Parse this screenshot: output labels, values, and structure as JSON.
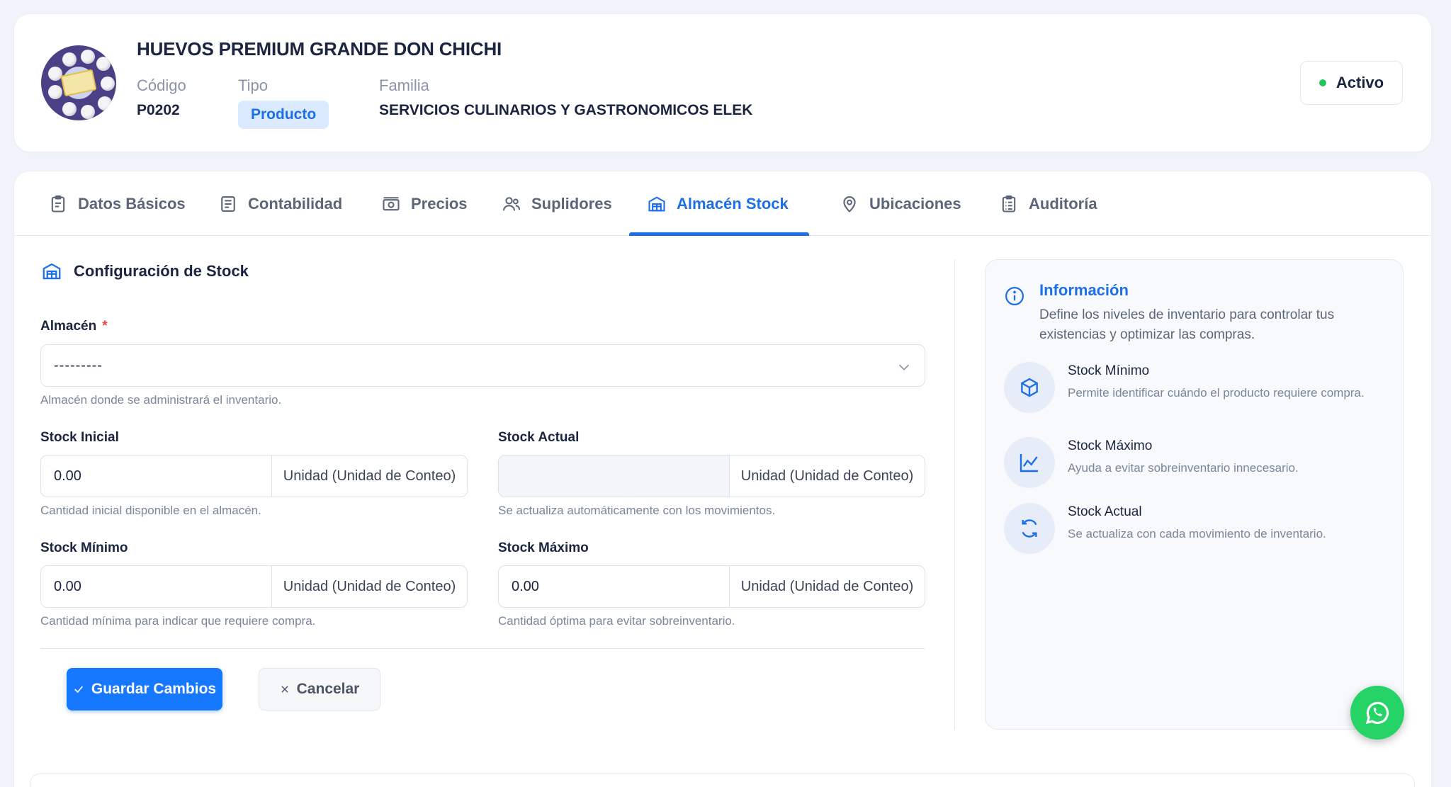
{
  "product": {
    "name": "HUEVOS PREMIUM GRANDE DON CHICHI",
    "code_label": "Código",
    "code": "P0202",
    "type_label": "Tipo",
    "type": "Producto",
    "family_label": "Familia",
    "family": "SERVICIOS CULINARIOS Y GASTRONOMICOS ELEK",
    "status": "Activo"
  },
  "tabs": [
    {
      "label": "Datos Básicos",
      "icon": "clipboard-icon"
    },
    {
      "label": "Contabilidad",
      "icon": "document-icon"
    },
    {
      "label": "Precios",
      "icon": "money-icon"
    },
    {
      "label": "Suplidores",
      "icon": "users-icon"
    },
    {
      "label": "Almacén Stock",
      "icon": "warehouse-icon",
      "active": true
    },
    {
      "label": "Ubicaciones",
      "icon": "map-pin-icon"
    },
    {
      "label": "Auditoría",
      "icon": "clipboard-list-icon"
    }
  ],
  "form": {
    "section_title": "Configuración de Stock",
    "warehouse_label": "Almacén",
    "required_mark": "*",
    "warehouse_value": "---------",
    "warehouse_hint": "Almacén donde se administrará el inventario.",
    "initial_label": "Stock Inicial",
    "initial_value": "0.00",
    "initial_unit": "Unidad (Unidad de Conteo)",
    "initial_hint": "Cantidad inicial disponible en el almacén.",
    "current_label": "Stock Actual",
    "current_value": "",
    "current_unit": "Unidad (Unidad de Conteo)",
    "current_hint": "Se actualiza automáticamente con los movimientos.",
    "min_label": "Stock Mínimo",
    "min_value": "0.00",
    "min_unit": "Unidad (Unidad de Conteo)",
    "min_hint": "Cantidad mínima para indicar que requiere compra.",
    "max_label": "Stock Máximo",
    "max_value": "0.00",
    "max_unit": "Unidad (Unidad de Conteo)",
    "max_hint": "Cantidad óptima para evitar sobreinventario.",
    "save_label": "Guardar Cambios",
    "cancel_label": "Cancelar"
  },
  "info": {
    "title": "Información",
    "description": "Define los niveles de inventario para controlar tus existencias y optimizar las compras.",
    "items": [
      {
        "title": "Stock Mínimo",
        "desc": "Permite identificar cuándo el producto requiere compra.",
        "icon": "box-icon"
      },
      {
        "title": "Stock Máximo",
        "desc": "Ayuda a evitar sobreinventario innecesario.",
        "icon": "chart-line-icon"
      },
      {
        "title": "Stock Actual",
        "desc": "Se actualiza con cada movimiento de inventario.",
        "icon": "refresh-icon"
      }
    ]
  },
  "colors": {
    "accent": "#1d6fe8",
    "primary_button": "#1677ff",
    "status_active": "#22c55e",
    "whatsapp": "#25d366"
  }
}
